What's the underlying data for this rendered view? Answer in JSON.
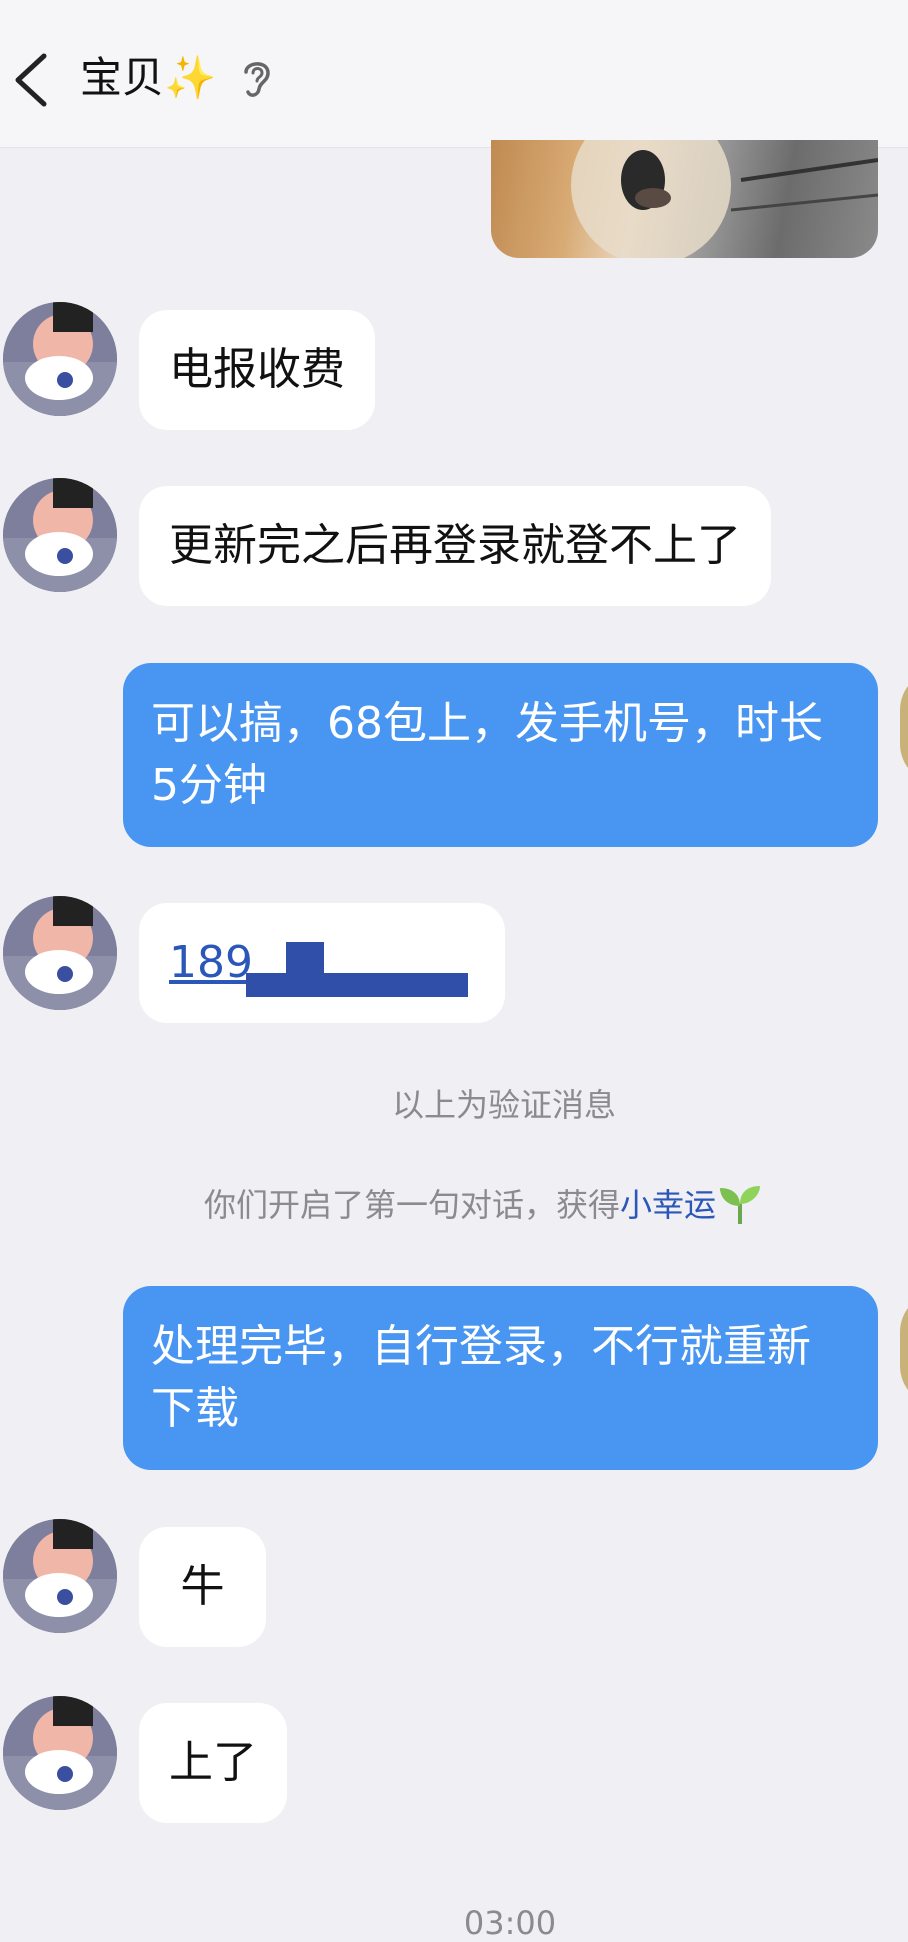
{
  "header": {
    "title": "宝贝✨",
    "back_icon": "chevron-left-icon",
    "ear_icon": "ear-icon"
  },
  "messages": [
    {
      "side": "in",
      "text": "电报收费"
    },
    {
      "side": "in",
      "text": "更新完之后再登录就登不上了"
    },
    {
      "side": "out",
      "text": "可以搞，68包上，发手机号，时长5分钟"
    },
    {
      "side": "in",
      "text": "189"
    },
    {
      "side": "out",
      "text": "处理完毕，自行登录，不行就重新下载"
    },
    {
      "side": "in",
      "text": "牛"
    },
    {
      "side": "in",
      "text": "上了"
    }
  ],
  "system": {
    "verify_note": "以上为验证消息",
    "first_chat_prefix": "你们开启了第一句对话，获得",
    "first_chat_link": "小幸运",
    "time": "03:00"
  },
  "colors": {
    "background": "#efeff4",
    "bubble_out": "#4895f2",
    "bubble_in": "#ffffff",
    "link": "#2b57b8"
  }
}
